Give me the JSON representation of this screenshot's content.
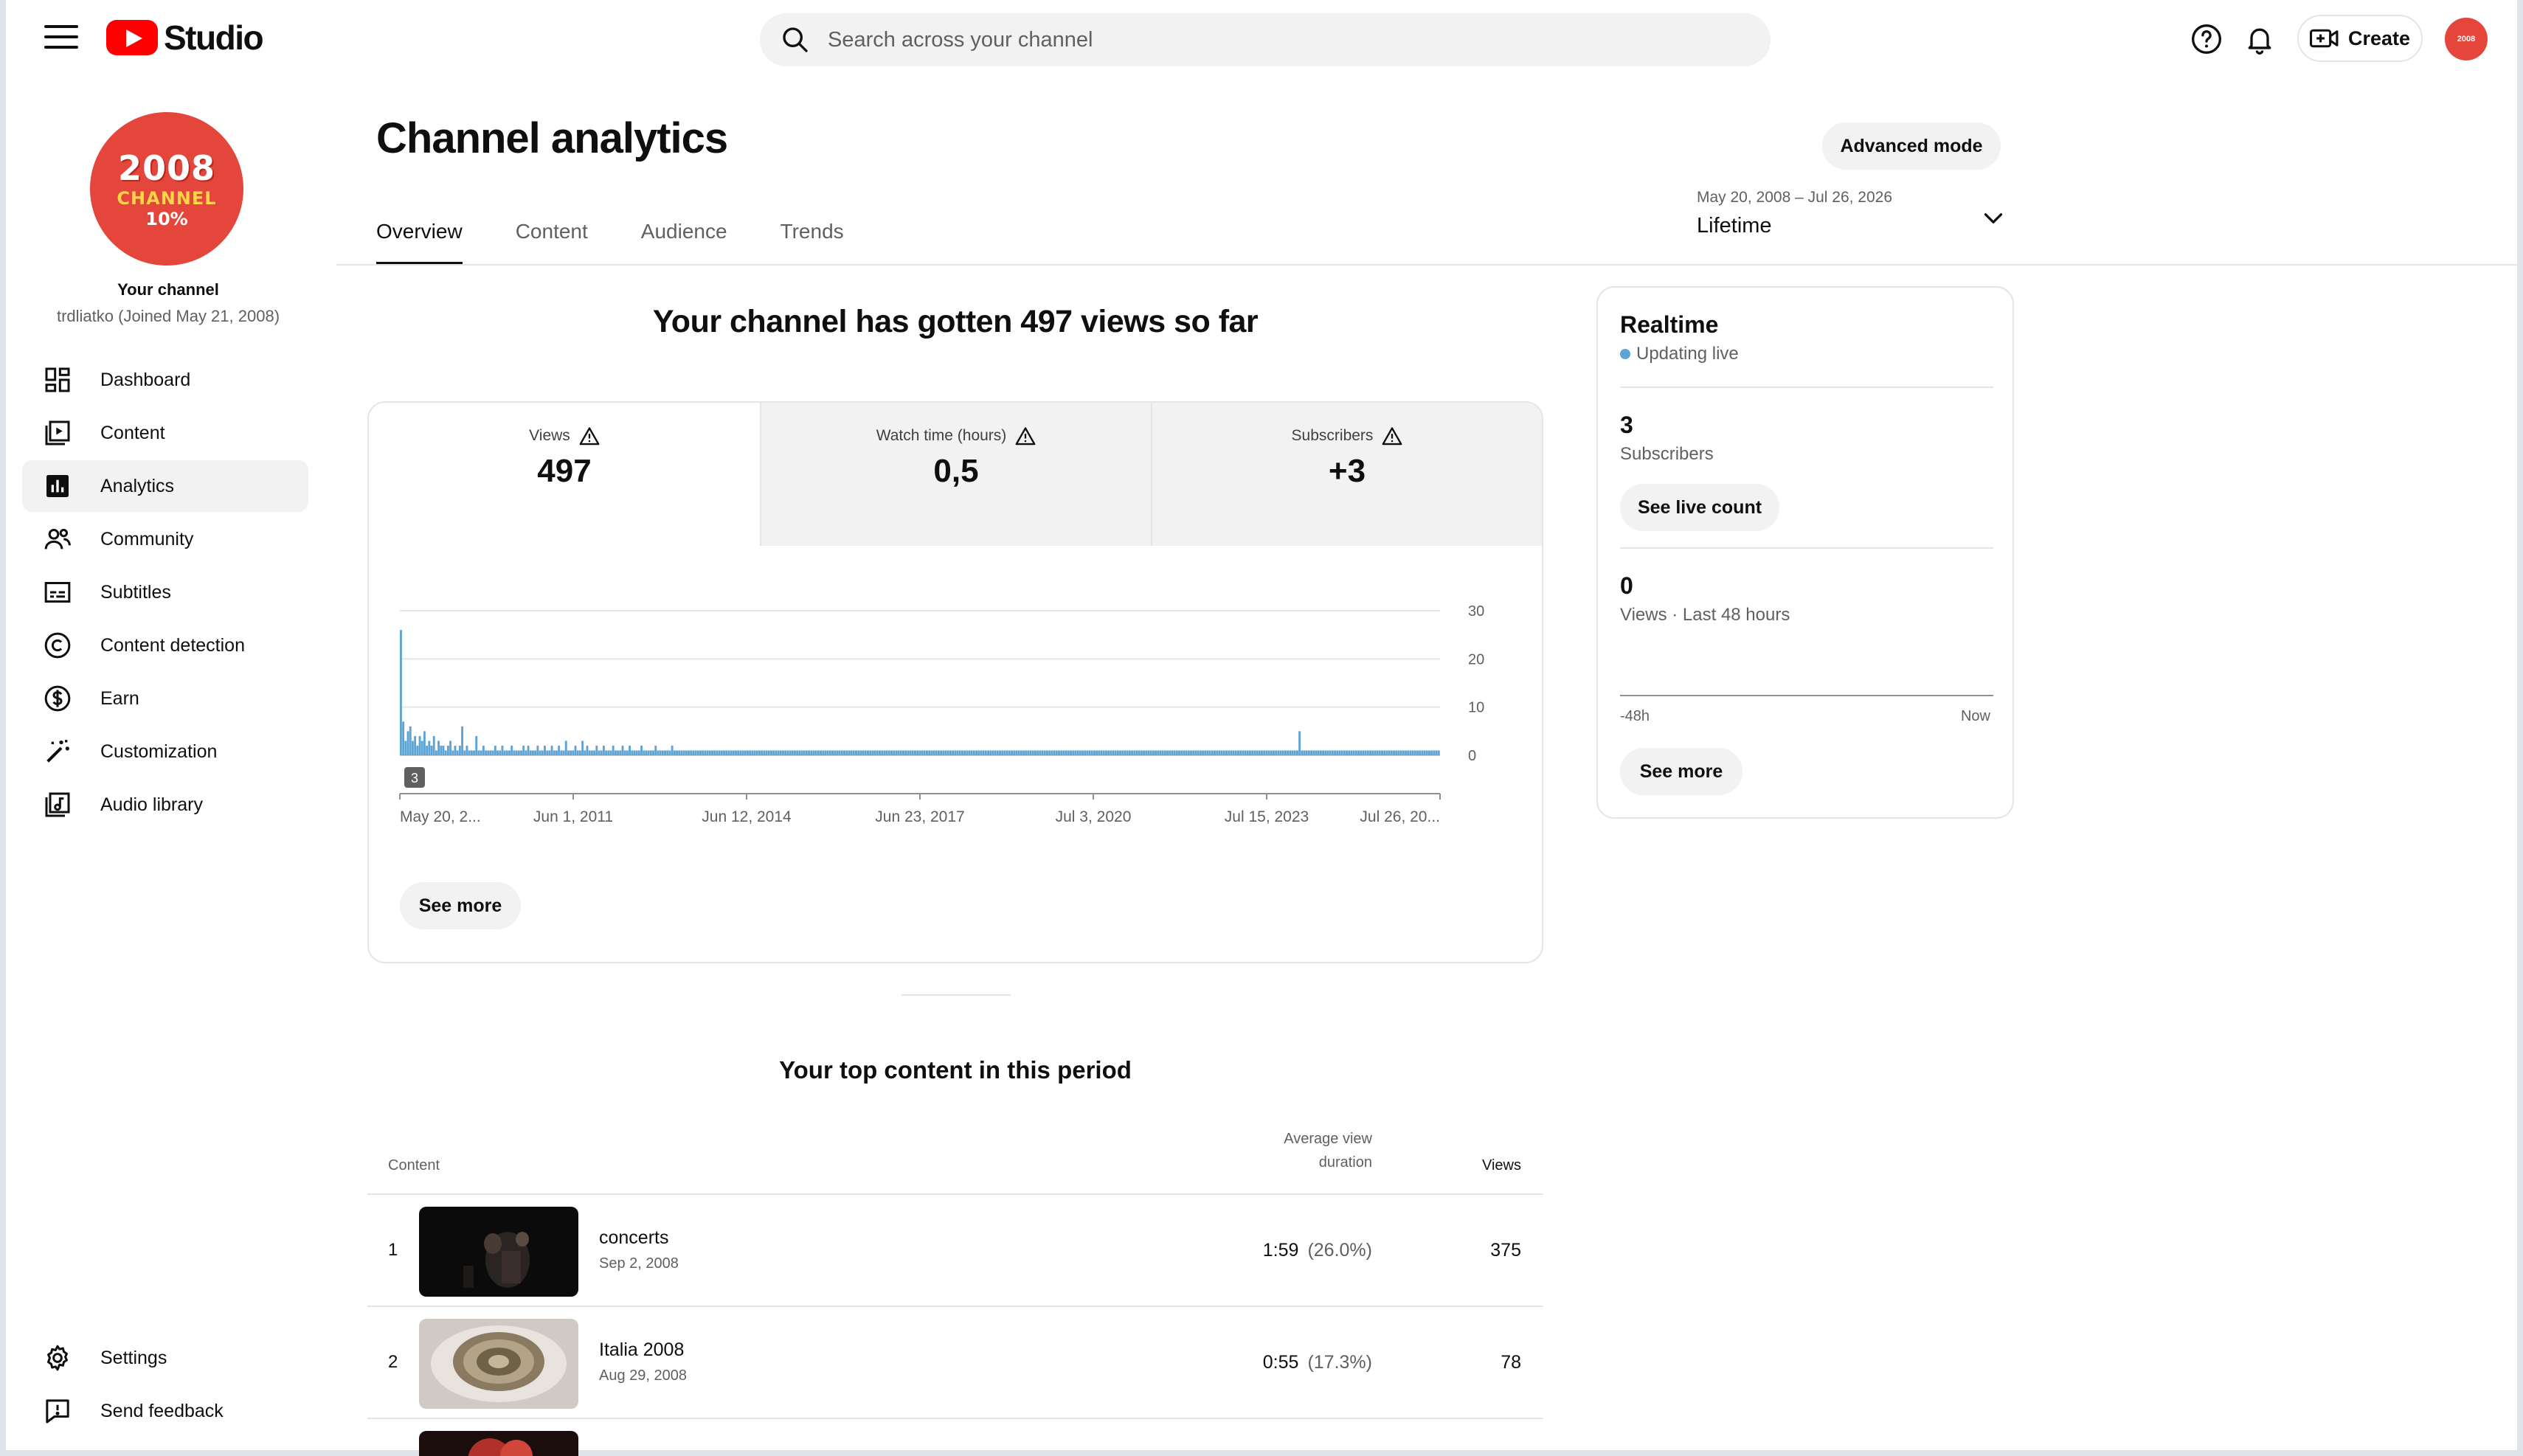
{
  "app": {
    "logo_text": "Studio",
    "search_placeholder": "Search across your channel",
    "create_label": "Create"
  },
  "channel": {
    "avatar_lines": [
      "2008",
      "CHANNEL",
      "10%"
    ],
    "your_channel_label": "Your channel",
    "handle": "trdliatko (Joined May 21, 2008)"
  },
  "sidebar": {
    "items": [
      {
        "label": "Dashboard",
        "icon": "dashboard-icon"
      },
      {
        "label": "Content",
        "icon": "content-icon"
      },
      {
        "label": "Analytics",
        "icon": "analytics-icon",
        "active": true
      },
      {
        "label": "Community",
        "icon": "community-icon"
      },
      {
        "label": "Subtitles",
        "icon": "subtitles-icon"
      },
      {
        "label": "Content detection",
        "icon": "copyright-icon"
      },
      {
        "label": "Earn",
        "icon": "dollar-icon"
      },
      {
        "label": "Customization",
        "icon": "magic-wand-icon"
      },
      {
        "label": "Audio library",
        "icon": "audio-library-icon"
      }
    ],
    "bottom": [
      {
        "label": "Settings",
        "icon": "gear-icon"
      },
      {
        "label": "Send feedback",
        "icon": "feedback-icon"
      }
    ]
  },
  "page": {
    "title": "Channel analytics",
    "advanced_mode": "Advanced mode",
    "tabs": [
      "Overview",
      "Content",
      "Audience",
      "Trends"
    ],
    "active_tab": "Overview",
    "date_range": {
      "sub": "May 20, 2008 – Jul 26, 2026",
      "main": "Lifetime"
    },
    "headline": "Your channel has gotten 497 views so far",
    "see_more": "See more"
  },
  "metrics": [
    {
      "label": "Views",
      "value": "497",
      "selected": true
    },
    {
      "label": "Watch time (hours)",
      "value": "0,5"
    },
    {
      "label": "Subscribers",
      "value": "+3"
    }
  ],
  "chart_data": {
    "type": "bar",
    "x_tick_labels": [
      "May 20, 2...",
      "Jun 1, 2011",
      "Jun 12, 2014",
      "Jun 23, 2017",
      "Jul 3, 2020",
      "Jul 15, 2023",
      "Jul 26, 20..."
    ],
    "y_ticks": [
      0,
      10,
      20,
      30
    ],
    "ylim": [
      0,
      30
    ],
    "marker_label": "3",
    "series": [
      {
        "values": [
          26,
          7,
          3,
          5,
          6,
          3,
          4,
          2,
          4,
          3,
          5,
          2,
          3,
          2,
          4,
          1,
          3,
          2,
          2,
          1,
          2,
          3,
          1,
          2,
          1,
          2,
          6,
          1,
          2,
          1,
          1,
          1,
          4,
          1,
          1,
          2,
          1,
          1,
          1,
          1,
          2,
          1,
          1,
          2,
          1,
          1,
          1,
          2,
          1,
          1,
          1,
          1,
          2,
          1,
          2,
          1,
          1,
          1,
          2,
          1,
          1,
          2,
          1,
          1,
          2,
          1,
          1,
          2,
          1,
          1,
          3,
          1,
          1,
          1,
          2,
          1,
          1,
          3,
          1,
          2,
          1,
          1,
          1,
          2,
          1,
          1,
          2,
          1,
          1,
          1,
          2,
          1,
          1,
          1,
          2,
          1,
          1,
          2,
          1,
          1,
          1,
          1,
          2,
          1,
          1,
          1,
          1,
          1,
          2,
          1,
          1,
          1,
          1,
          1,
          1,
          2,
          1,
          1,
          1,
          1,
          1,
          1,
          1,
          1,
          1,
          1,
          1,
          1,
          1,
          1,
          1,
          1,
          1,
          1,
          1,
          1,
          1,
          1,
          1,
          1,
          1,
          1,
          1,
          1,
          1,
          1,
          1,
          1,
          1,
          1,
          1,
          1,
          1,
          1,
          1,
          1,
          1,
          1,
          1,
          1,
          1,
          1,
          1,
          1,
          1,
          1,
          1,
          1,
          1,
          1,
          1,
          1,
          1,
          1,
          1,
          1,
          1,
          1,
          1,
          1,
          1,
          1,
          1,
          1,
          1,
          1,
          1,
          1,
          1,
          1,
          1,
          1,
          1,
          1,
          1,
          1,
          1,
          1,
          1,
          1,
          1,
          1,
          1,
          1,
          1,
          1,
          1,
          1,
          1,
          1,
          1,
          1,
          1,
          1,
          1,
          1,
          1,
          1,
          1,
          1,
          1,
          1,
          1,
          1,
          1,
          1,
          1,
          1,
          1,
          1,
          1,
          1,
          1,
          1,
          1,
          1,
          1,
          1,
          1,
          1,
          1,
          1,
          1,
          1,
          1,
          1,
          1,
          1,
          1,
          1,
          1,
          1,
          1,
          1,
          1,
          1,
          1,
          1,
          1,
          1,
          1,
          1,
          1,
          1,
          1,
          1,
          1,
          1,
          1,
          1,
          1,
          1,
          1,
          1,
          1,
          1,
          1,
          1,
          1,
          1,
          1,
          1,
          1,
          1,
          1,
          1,
          1,
          1,
          1,
          1,
          1,
          1,
          1,
          1,
          1,
          1,
          1,
          1,
          1,
          1,
          1,
          1,
          1,
          1,
          1,
          1,
          1,
          1,
          1,
          1,
          1,
          1,
          1,
          1,
          1,
          1,
          1,
          1,
          1,
          1,
          1,
          1,
          1,
          1,
          1,
          1,
          1,
          1,
          1,
          1,
          1,
          1,
          1,
          1,
          1,
          1,
          1,
          1,
          1,
          1,
          1,
          1,
          1,
          1,
          1,
          1,
          1,
          1,
          1,
          1,
          1,
          1,
          1,
          1,
          1,
          1,
          1,
          1,
          1,
          1,
          1,
          1,
          1,
          1,
          1,
          1,
          1,
          1,
          1,
          1,
          1,
          1,
          1,
          1,
          1,
          1,
          1,
          1,
          1,
          1,
          1,
          5,
          1,
          1,
          1,
          1,
          1,
          1,
          1,
          1,
          1,
          1,
          1,
          1,
          1,
          1,
          1,
          1,
          1,
          1,
          1,
          1,
          1,
          1,
          1,
          1,
          1,
          1,
          1,
          1,
          1,
          1,
          1,
          1,
          1,
          1,
          1,
          1,
          1,
          1,
          1,
          1,
          1,
          1,
          1,
          1,
          1,
          1,
          1,
          1,
          1,
          1,
          1,
          1,
          1,
          1,
          1,
          1,
          1,
          1,
          1
        ],
        "color": "#5ca3d6"
      }
    ]
  },
  "top_content": {
    "title": "Your top content in this period",
    "columns": {
      "content": "Content",
      "avd": [
        "Average view",
        "duration"
      ],
      "views": "Views"
    },
    "rows": [
      {
        "rank": "1",
        "title": "concerts",
        "date": "Sep 2, 2008",
        "avd": "1:59",
        "avd_pct": "(26.0%)",
        "views": "375"
      },
      {
        "rank": "2",
        "title": "Italia 2008",
        "date": "Aug 29, 2008",
        "avd": "0:55",
        "avd_pct": "(17.3%)",
        "views": "78"
      }
    ]
  },
  "realtime": {
    "title": "Realtime",
    "status": "Updating live",
    "subs_value": "3",
    "subs_label": "Subscribers",
    "live_count_btn": "See live count",
    "views_value": "0",
    "views_label": "Views · Last 48 hours",
    "axis_left": "-48h",
    "axis_right": "Now",
    "see_more": "See more"
  },
  "colors": {
    "accent": "#5ca3d6",
    "brand": "#ff0000",
    "avatar": "#e4463c"
  }
}
